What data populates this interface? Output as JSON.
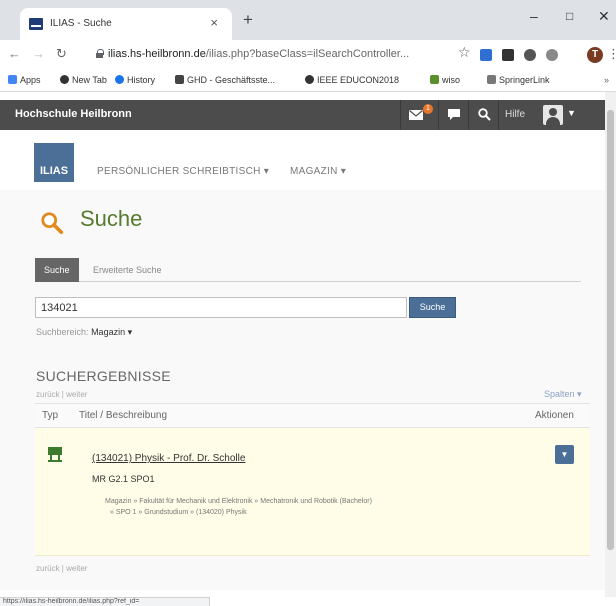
{
  "browser": {
    "tab_title": "ILIAS - Suche",
    "tab_close": "×",
    "new_tab": "+",
    "url_host": "ilias.hs-heilbronn.de",
    "url_path": "/ilias.php?baseClass=ilSearchController...",
    "profile_initial": "T",
    "bookmarks": [
      "Apps",
      "New Tab",
      "History",
      "GHD - Geschäftsste...",
      "IEEE EDUCON2018",
      "wiso",
      "SpringerLink"
    ]
  },
  "ilias": {
    "institution": "Hochschule Heilbronn",
    "mail_badge": "1",
    "help": "Hilfe",
    "logo": "ILIAS",
    "menu": [
      "PERSÖNLICHER SCHREIBTISCH",
      "MAGAZIN"
    ],
    "page_title": "Suche",
    "tabs": [
      "Suche",
      "Erweiterte Suche"
    ],
    "search_value": "134021",
    "search_button": "Suche",
    "scope_label": "Suchbereich:",
    "scope_value": "Magazin",
    "results_header": "SUCHERGEBNISSE",
    "nav": "zurück | weiter",
    "columns": "Spalten",
    "col_type": "Typ",
    "col_title": "Titel / Beschreibung",
    "col_actions": "Aktionen",
    "result": {
      "title": "(134021) Physik - Prof. Dr. Scholle",
      "subtitle": "MR G2.1 SPO1",
      "path_line1": "Magazin  »  Fakultät für Mechanik und Elektronik  »  Mechatronik und Robotik (Bachelor)",
      "path_line2": "»  SPO 1  »  Grundstudium  »  (134020) Physik"
    },
    "status_url": "https://ilias.hs-heilbronn.de/ilias.php?ref_id="
  },
  "colors": {
    "ilias_blue": "#4b6f96",
    "title_green": "#557b2e",
    "topbar": "#4c4c4c",
    "result_highlight": "#fffde8"
  }
}
